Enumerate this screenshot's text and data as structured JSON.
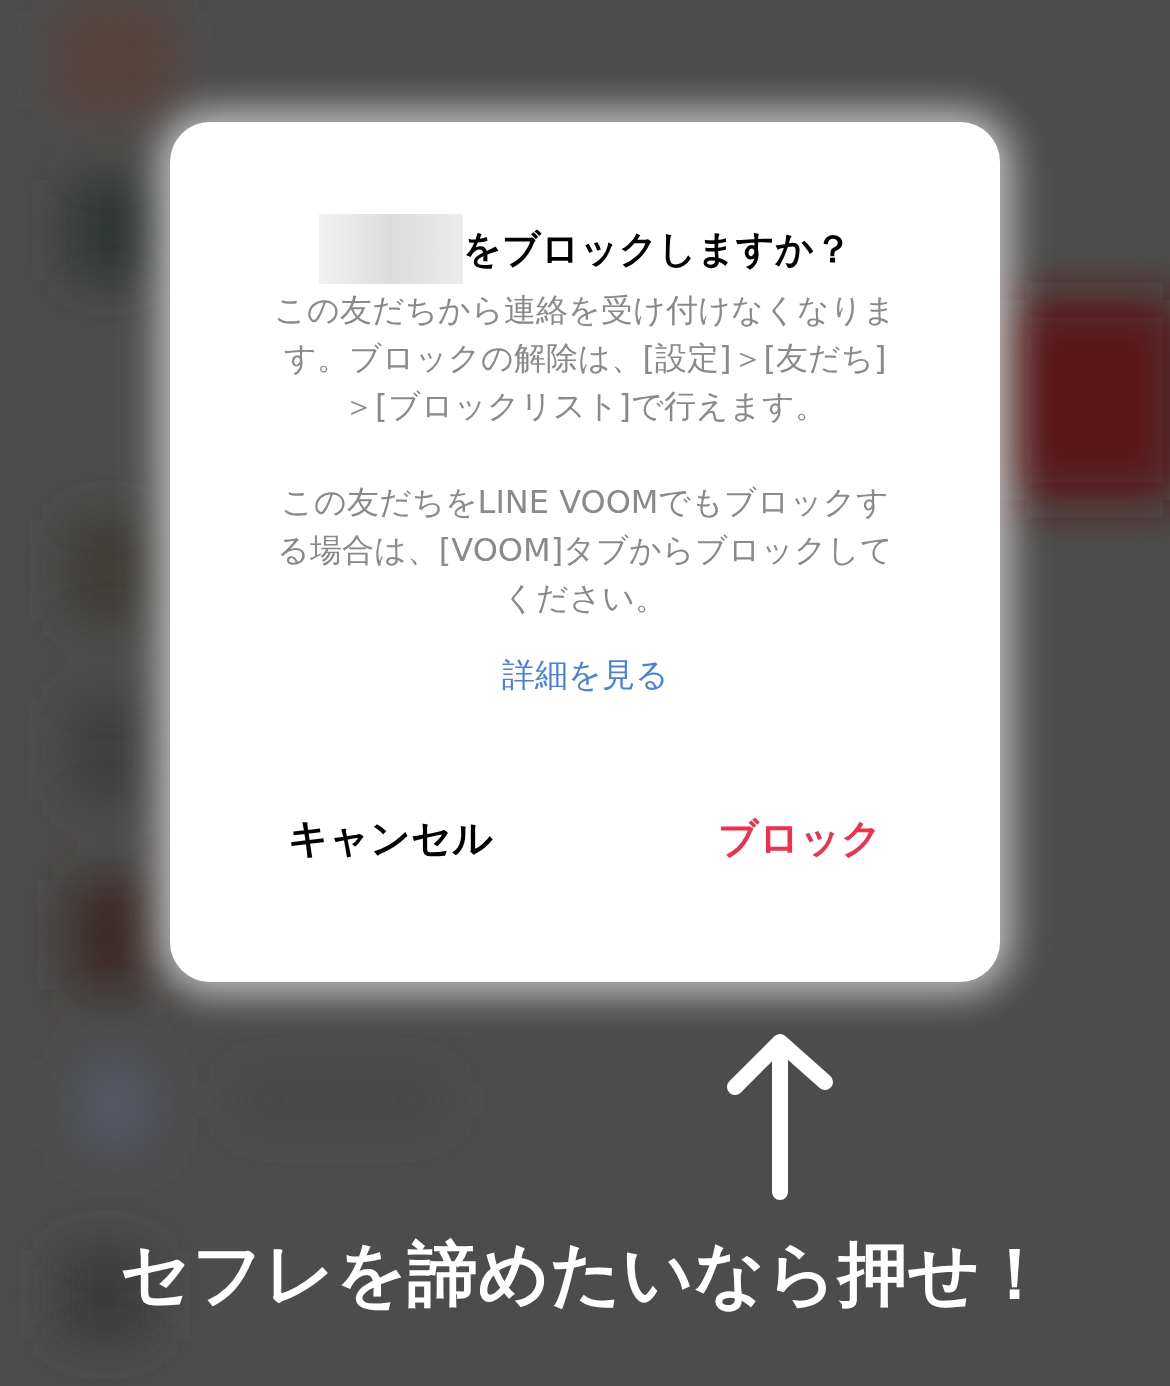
{
  "dialog": {
    "title": "をブロックしますか？",
    "paragraphs": [
      "この友だちから連絡を受け付けなくなります。ブロックの解除は、[設定]＞[友だち]＞[ブロックリスト]で行えます。",
      "この友だちをLINE VOOMでもブロックする場合は、[VOOM]タブからブロックしてください。"
    ],
    "link": "詳細を見る",
    "buttons": [
      {
        "label": "キャンセル",
        "kind": "cancel"
      },
      {
        "label": "ブロック",
        "kind": "destructive"
      }
    ]
  },
  "annotation": {
    "text": "セフレを諦めたいなら押せ！"
  }
}
